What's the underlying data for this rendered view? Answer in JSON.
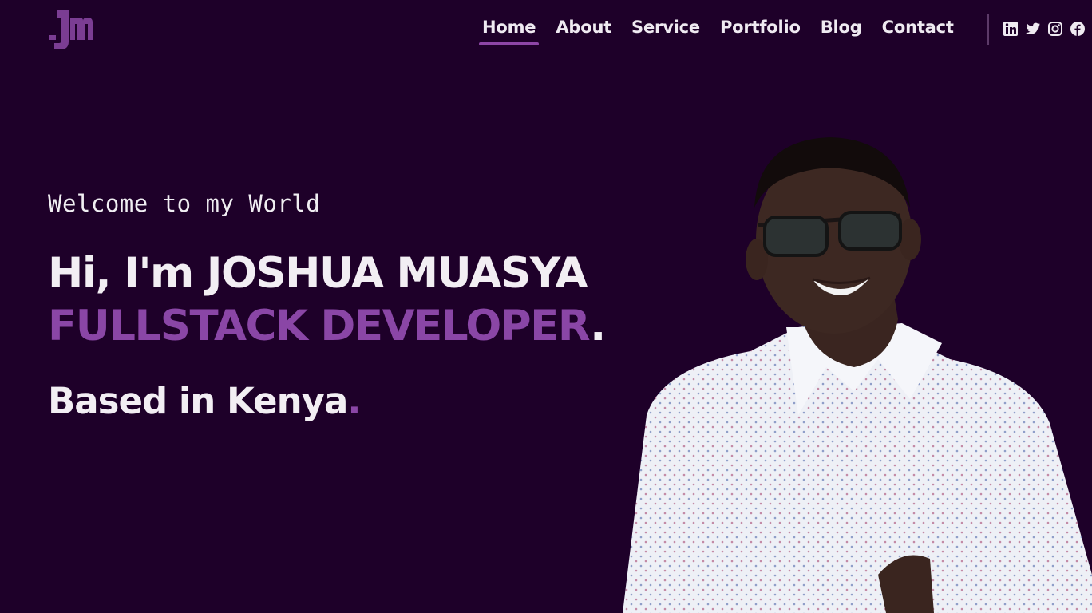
{
  "brand": {
    "logo_text": "Jm",
    "logo_color": "#7b3d93"
  },
  "colors": {
    "background": "#1e0029",
    "accent": "#8a46a6",
    "text": "#f2eef3"
  },
  "nav": {
    "items": [
      {
        "label": "Home",
        "active": true
      },
      {
        "label": "About"
      },
      {
        "label": "Service"
      },
      {
        "label": "Portfolio"
      },
      {
        "label": "Blog"
      },
      {
        "label": "Contact"
      }
    ]
  },
  "social": [
    "linkedin-icon",
    "twitter-icon",
    "instagram-icon",
    "facebook-icon"
  ],
  "hero": {
    "welcome": "Welcome to my World",
    "greeting": "Hi, I'm JOSHUA MUASYA",
    "role": "FULLSTACK DEVELOPER",
    "role_suffix": ".",
    "location": "Based in Kenya",
    "location_suffix": "."
  }
}
